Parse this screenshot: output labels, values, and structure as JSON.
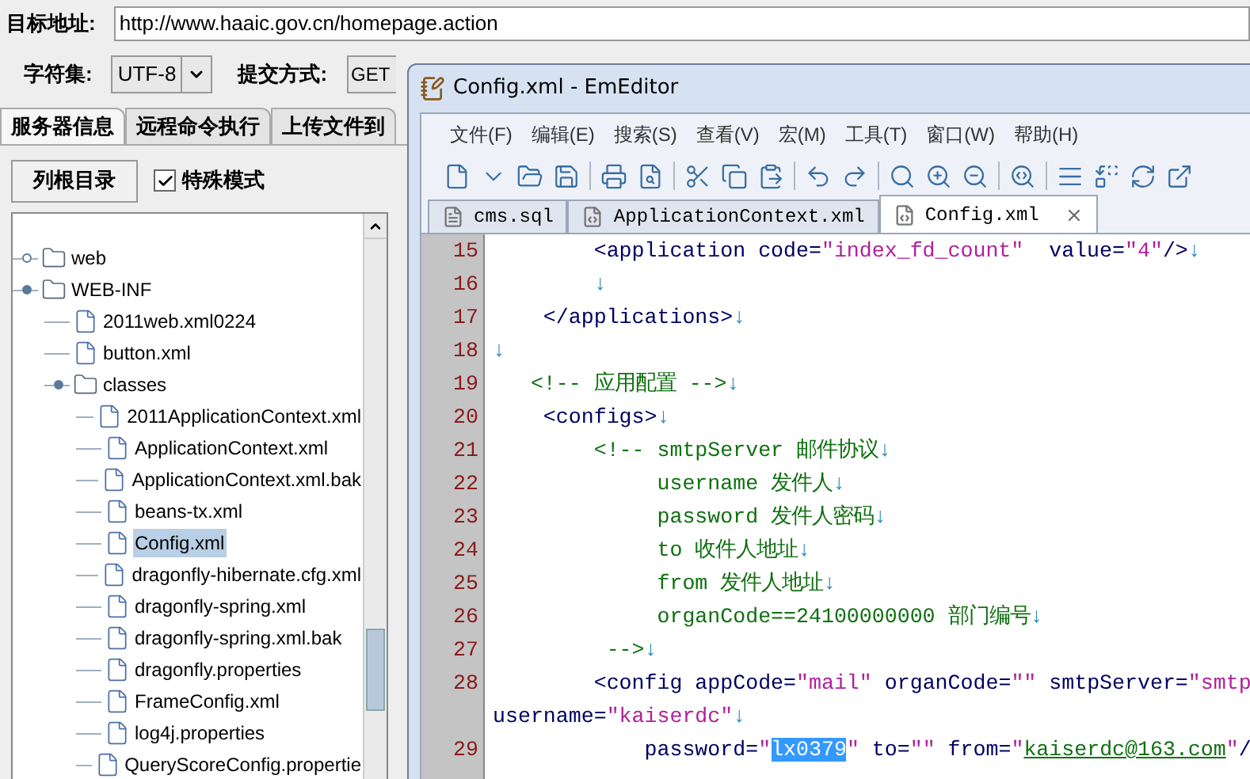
{
  "form": {
    "url_label": "目标地址:",
    "url": "http://www.haaic.gov.cn/homepage.action",
    "charset_label": "字符集:",
    "charset": "UTF-8",
    "method_label": "提交方式:",
    "method": "GET"
  },
  "tabs": [
    {
      "label": "服务器信息",
      "selected": true
    },
    {
      "label": "远程命令执行",
      "selected": false
    },
    {
      "label": "上传文件到",
      "selected": false
    }
  ],
  "list_root_button": "列根目录",
  "special_mode": {
    "label": "特殊模式",
    "checked": true
  },
  "tree": [
    {
      "kind": "folder",
      "label": "web",
      "expanded": false,
      "selected": false
    },
    {
      "kind": "folder",
      "label": "WEB-INF",
      "expanded": true,
      "selected": false,
      "children": [
        {
          "kind": "file",
          "label": "2011web.xml0224",
          "selected": false
        },
        {
          "kind": "file",
          "label": "button.xml",
          "selected": false
        },
        {
          "kind": "folder",
          "label": "classes",
          "expanded": true,
          "selected": false,
          "children": [
            {
              "kind": "file",
              "label": "2011ApplicationContext.xml",
              "selected": false
            },
            {
              "kind": "file",
              "label": "ApplicationContext.xml",
              "selected": false
            },
            {
              "kind": "file",
              "label": "ApplicationContext.xml.bak",
              "selected": false
            },
            {
              "kind": "file",
              "label": "beans-tx.xml",
              "selected": false
            },
            {
              "kind": "file",
              "label": "Config.xml",
              "selected": true
            },
            {
              "kind": "file",
              "label": "dragonfly-hibernate.cfg.xml",
              "selected": false
            },
            {
              "kind": "file",
              "label": "dragonfly-spring.xml",
              "selected": false
            },
            {
              "kind": "file",
              "label": "dragonfly-spring.xml.bak",
              "selected": false
            },
            {
              "kind": "file",
              "label": "dragonfly.properties",
              "selected": false
            },
            {
              "kind": "file",
              "label": "FrameConfig.xml",
              "selected": false
            },
            {
              "kind": "file",
              "label": "log4j.properties",
              "selected": false
            },
            {
              "kind": "file",
              "label": "QueryScoreConfig.propertie",
              "selected": false
            }
          ]
        }
      ]
    }
  ],
  "editor": {
    "title": "Config.xml - EmEditor",
    "menu": [
      "文件(F)",
      "编辑(E)",
      "搜索(S)",
      "查看(V)",
      "宏(M)",
      "工具(T)",
      "窗口(W)",
      "帮助(H)"
    ],
    "tabs": [
      {
        "label": "cms.sql",
        "selected": false
      },
      {
        "label": "ApplicationContext.xml",
        "selected": false
      },
      {
        "label": "Config.xml",
        "selected": true
      }
    ],
    "lines": [
      {
        "number": "15",
        "segments": [
          {
            "kind": "tag",
            "text": "        <application code="
          },
          {
            "kind": "string",
            "text": "\"index_fd_count\""
          },
          {
            "kind": "tag",
            "text": "  value="
          },
          {
            "kind": "string",
            "text": "\"4\""
          },
          {
            "kind": "tag",
            "text": "/>"
          },
          {
            "kind": "eol",
            "text": "↓"
          }
        ]
      },
      {
        "number": "16",
        "segments": [
          {
            "kind": "eol",
            "text": "        ↓"
          }
        ]
      },
      {
        "number": "17",
        "segments": [
          {
            "kind": "tag",
            "text": "    </applications>"
          },
          {
            "kind": "eol",
            "text": "↓"
          }
        ]
      },
      {
        "number": "18",
        "segments": [
          {
            "kind": "eol",
            "text": "↓"
          }
        ]
      },
      {
        "number": "19",
        "segments": [
          {
            "kind": "comment",
            "text": "   <!-- 应用配置 -->"
          },
          {
            "kind": "eol",
            "text": "↓"
          }
        ]
      },
      {
        "number": "20",
        "segments": [
          {
            "kind": "tag",
            "text": "    <configs>"
          },
          {
            "kind": "eol",
            "text": "↓"
          }
        ]
      },
      {
        "number": "21",
        "segments": [
          {
            "kind": "comment",
            "text": "        <!-- smtpServer 邮件协议"
          },
          {
            "kind": "eol",
            "text": "↓"
          }
        ]
      },
      {
        "number": "22",
        "segments": [
          {
            "kind": "comment",
            "text": "             username 发件人"
          },
          {
            "kind": "eol",
            "text": "↓"
          }
        ]
      },
      {
        "number": "23",
        "segments": [
          {
            "kind": "comment",
            "text": "             password 发件人密码"
          },
          {
            "kind": "eol",
            "text": "↓"
          }
        ]
      },
      {
        "number": "24",
        "segments": [
          {
            "kind": "comment",
            "text": "             to 收件人地址"
          },
          {
            "kind": "eol",
            "text": "↓"
          }
        ]
      },
      {
        "number": "25",
        "segments": [
          {
            "kind": "comment",
            "text": "             from 发件人地址"
          },
          {
            "kind": "eol",
            "text": "↓"
          }
        ]
      },
      {
        "number": "26",
        "segments": [
          {
            "kind": "comment",
            "text": "             organCode==24100000000 部门编号"
          },
          {
            "kind": "eol",
            "text": "↓"
          }
        ]
      },
      {
        "number": "27",
        "segments": [
          {
            "kind": "comment",
            "text": "         -->"
          },
          {
            "kind": "eol",
            "text": "↓"
          }
        ]
      },
      {
        "number": "28",
        "segments": [
          {
            "kind": "tag",
            "text": "        <config appCode="
          },
          {
            "kind": "string",
            "text": "\"mail\""
          },
          {
            "kind": "tag",
            "text": " organCode="
          },
          {
            "kind": "string",
            "text": "\"\""
          },
          {
            "kind": "tag",
            "text": " smtpServer="
          },
          {
            "kind": "string",
            "text": "\"smtp"
          }
        ]
      },
      {
        "segments": [
          {
            "kind": "tag",
            "text": "username="
          },
          {
            "kind": "string",
            "text": "\"kaiserdc\""
          },
          {
            "kind": "eol",
            "text": "↓"
          }
        ]
      },
      {
        "number": "29",
        "segments": [
          {
            "kind": "tag",
            "text": "            password="
          },
          {
            "kind": "string",
            "text": "\""
          },
          {
            "kind": "selection",
            "text": "lx0379"
          },
          {
            "kind": "string",
            "text": "\""
          },
          {
            "kind": "tag",
            "text": " to="
          },
          {
            "kind": "string",
            "text": "\"\""
          },
          {
            "kind": "tag",
            "text": " from="
          },
          {
            "kind": "string",
            "text": "\""
          },
          {
            "kind": "link",
            "text": "kaiserdc@163.com"
          },
          {
            "kind": "string",
            "text": "\""
          },
          {
            "kind": "tag",
            "text": "/"
          }
        ]
      }
    ]
  }
}
